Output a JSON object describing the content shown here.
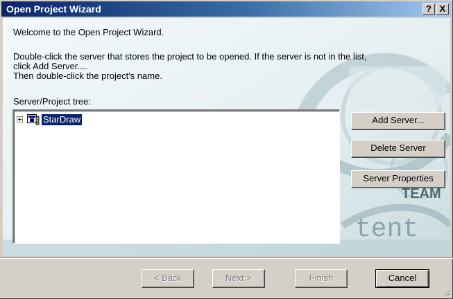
{
  "window": {
    "title": "Open Project Wizard",
    "help_label": "?",
    "close_label": "X"
  },
  "content": {
    "welcome": "Welcome to the Open Project Wizard.",
    "instructions": "Double-click the server that stores the project to be opened. If the server is not in the list,\nclick Add Server....\nThen double-click the project's name.",
    "tree_label": "Server/Project tree:"
  },
  "tree": {
    "nodes": [
      {
        "label": "StarDraw",
        "icon": "server-icon",
        "expanded": false,
        "selected": true
      }
    ]
  },
  "side_buttons": {
    "add_server": "Add Server...",
    "delete_server": "Delete Server",
    "server_properties": "Server Properties"
  },
  "background": {
    "team_text": "TEAM",
    "tent_text": "tent"
  },
  "footer": {
    "back": "< Back",
    "next": "Next >",
    "finish": "Finish",
    "cancel": "Cancel"
  }
}
